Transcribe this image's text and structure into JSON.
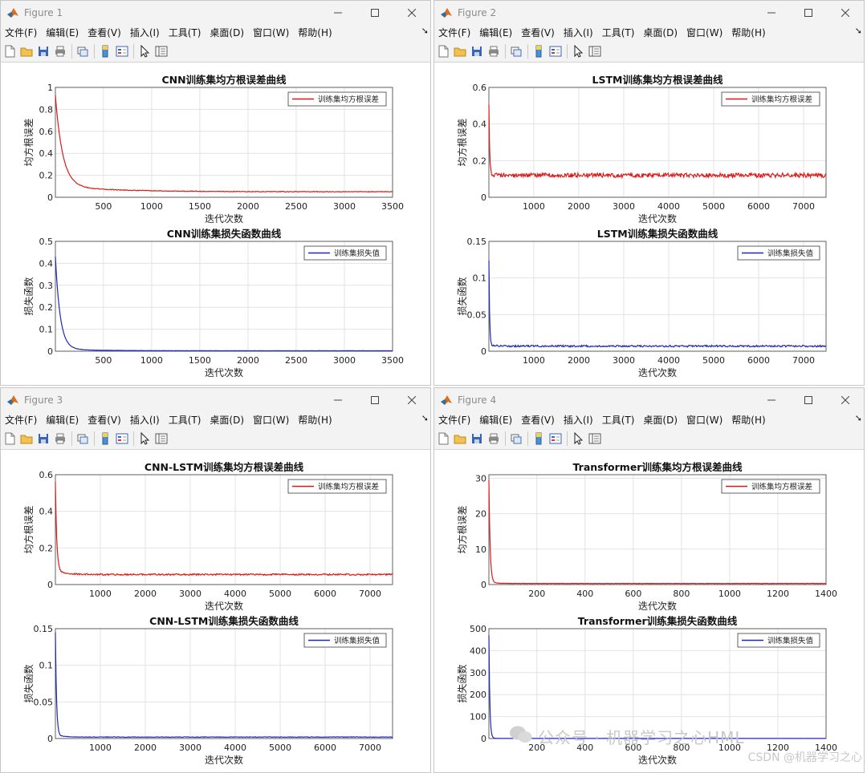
{
  "menu": [
    "文件(F)",
    "编辑(E)",
    "查看(V)",
    "插入(I)",
    "工具(T)",
    "桌面(D)",
    "窗口(W)",
    "帮助(H)"
  ],
  "toolbar": [
    "new-file-icon",
    "open-folder-icon",
    "save-icon",
    "print-icon",
    "link-figure-icon",
    "colorbar-icon",
    "legend-icon",
    "pointer-icon",
    "property-inspector-icon"
  ],
  "colors": {
    "rmse_line": "#dd1a1a",
    "loss_line": "#1f27b8",
    "grid": "#e2e2e2"
  },
  "windows": [
    {
      "title": "Figure 1",
      "charts": [
        {
          "title": "CNN训练集均方根误差曲线",
          "xlabel": "迭代次数",
          "ylabel": "均方根误差",
          "xlim": [
            1,
            3500
          ],
          "ylim": [
            0,
            1
          ],
          "xticks": [
            500,
            1000,
            1500,
            2000,
            2500,
            3000,
            3500
          ],
          "yticks": [
            0,
            0.2,
            0.4,
            0.6,
            0.8,
            1
          ],
          "ytick_labels": [
            "0",
            "0.2",
            "0.4",
            "0.6",
            "0.8",
            "1"
          ],
          "legend": "训练集均方根误差",
          "color": "rmse",
          "curve": {
            "peak": 0.93,
            "mid": 0.1,
            "floor": 0.05,
            "knee": 300,
            "noise": 0.003
          }
        },
        {
          "title": "CNN训练集损失函数曲线",
          "xlabel": "迭代次数",
          "ylabel": "损失函数",
          "xlim": [
            1,
            3500
          ],
          "ylim": [
            0,
            0.5
          ],
          "xticks": [
            500,
            1000,
            1500,
            2000,
            2500,
            3000,
            3500
          ],
          "yticks": [
            0,
            0.1,
            0.2,
            0.3,
            0.4,
            0.5
          ],
          "ytick_labels": [
            "0",
            "0.1",
            "0.2",
            "0.3",
            "0.4",
            "0.5"
          ],
          "legend": "训练集损失值",
          "color": "loss",
          "curve": {
            "peak": 0.43,
            "mid": 0.01,
            "floor": 0.002,
            "knee": 200,
            "noise": 0.0005
          }
        }
      ]
    },
    {
      "title": "Figure 2",
      "charts": [
        {
          "title": "LSTM训练集均方根误差曲线",
          "xlabel": "迭代次数",
          "ylabel": "均方根误差",
          "xlim": [
            1,
            7500
          ],
          "ylim": [
            0,
            0.6
          ],
          "xticks": [
            1000,
            2000,
            3000,
            4000,
            5000,
            6000,
            7000
          ],
          "yticks": [
            0,
            0.2,
            0.4,
            0.6
          ],
          "ytick_labels": [
            "0",
            "0.2",
            "0.4",
            "0.6"
          ],
          "legend": "训练集均方根误差",
          "color": "rmse",
          "curve": {
            "peak": 0.5,
            "mid": 0.13,
            "floor": 0.12,
            "knee": 60,
            "noise": 0.012
          }
        },
        {
          "title": "LSTM训练集损失函数曲线",
          "xlabel": "迭代次数",
          "ylabel": "损失函数",
          "xlim": [
            1,
            7500
          ],
          "ylim": [
            0,
            0.15
          ],
          "xticks": [
            1000,
            2000,
            3000,
            4000,
            5000,
            6000,
            7000
          ],
          "yticks": [
            0,
            0.05,
            0.1,
            0.15
          ],
          "ytick_labels": [
            "0",
            "0.05",
            "0.1",
            "0.15"
          ],
          "legend": "训练集损失值",
          "color": "loss",
          "curve": {
            "peak": 0.125,
            "mid": 0.008,
            "floor": 0.007,
            "knee": 60,
            "noise": 0.0012
          }
        }
      ]
    },
    {
      "title": "Figure 3",
      "charts": [
        {
          "title": "CNN-LSTM训练集均方根误差曲线",
          "xlabel": "迭代次数",
          "ylabel": "均方根误差",
          "xlim": [
            1,
            7500
          ],
          "ylim": [
            0,
            0.6
          ],
          "xticks": [
            1000,
            2000,
            3000,
            4000,
            5000,
            6000,
            7000
          ],
          "yticks": [
            0,
            0.2,
            0.4,
            0.6
          ],
          "ytick_labels": [
            "0",
            "0.2",
            "0.4",
            "0.6"
          ],
          "legend": "训练集均方根误差",
          "color": "rmse",
          "curve": {
            "peak": 0.56,
            "mid": 0.075,
            "floor": 0.055,
            "knee": 120,
            "noise": 0.004
          }
        },
        {
          "title": "CNN-LSTM训练集损失函数曲线",
          "xlabel": "迭代次数",
          "ylabel": "损失函数",
          "xlim": [
            1,
            7500
          ],
          "ylim": [
            0,
            0.15
          ],
          "xticks": [
            1000,
            2000,
            3000,
            4000,
            5000,
            6000,
            7000
          ],
          "yticks": [
            0,
            0.05,
            0.1,
            0.15
          ],
          "ytick_labels": [
            "0",
            "0.05",
            "0.1",
            "0.15"
          ],
          "legend": "训练集损失值",
          "color": "loss",
          "curve": {
            "peak": 0.145,
            "mid": 0.004,
            "floor": 0.002,
            "knee": 100,
            "noise": 0.0004
          }
        }
      ]
    },
    {
      "title": "Figure 4",
      "charts": [
        {
          "title": "Transformer训练集均方根误差曲线",
          "xlabel": "迭代次数",
          "ylabel": "均方根误差",
          "xlim": [
            1,
            1400
          ],
          "ylim": [
            0,
            31
          ],
          "xticks": [
            200,
            400,
            600,
            800,
            1000,
            1200,
            1400
          ],
          "yticks": [
            0,
            10,
            20,
            30
          ],
          "ytick_labels": [
            "0",
            "10",
            "20",
            "30"
          ],
          "legend": "训练集均方根误差",
          "color": "rmse",
          "curve": {
            "peak": 29.5,
            "mid": 0.5,
            "floor": 0.3,
            "knee": 20,
            "noise": 0.05
          }
        },
        {
          "title": "Transformer训练集损失函数曲线",
          "xlabel": "迭代次数",
          "ylabel": "损失函数",
          "xlim": [
            1,
            1400
          ],
          "ylim": [
            0,
            500
          ],
          "xticks": [
            200,
            400,
            600,
            800,
            1000,
            1200,
            1400
          ],
          "yticks": [
            0,
            100,
            200,
            300,
            400,
            500
          ],
          "ytick_labels": [
            "0",
            "100",
            "200",
            "300",
            "400",
            "500"
          ],
          "legend": "训练集损失值",
          "color": "loss",
          "curve": {
            "peak": 470,
            "mid": 1,
            "floor": 0.5,
            "knee": 15,
            "noise": 0.2
          }
        }
      ]
    }
  ],
  "watermark": {
    "main": "公众号 · 机器学习之心HML",
    "sub": "CSDN @机器学习之心"
  },
  "chart_data": [
    {
      "type": "line",
      "title": "CNN训练集均方根误差曲线",
      "xlabel": "迭代次数",
      "ylabel": "均方根误差",
      "xlim": [
        1,
        3500
      ],
      "ylim": [
        0,
        1
      ],
      "legend": "训练集均方根误差",
      "series": [
        {
          "name": "训练集均方根误差",
          "x": [
            1,
            50,
            100,
            200,
            300,
            500,
            1000,
            2000,
            3000,
            3500
          ],
          "y": [
            0.93,
            0.45,
            0.25,
            0.1,
            0.06,
            0.05,
            0.05,
            0.05,
            0.05,
            0.05
          ]
        }
      ]
    },
    {
      "type": "line",
      "title": "CNN训练集损失函数曲线",
      "xlabel": "迭代次数",
      "ylabel": "损失函数",
      "xlim": [
        1,
        3500
      ],
      "ylim": [
        0,
        0.5
      ],
      "legend": "训练集损失值",
      "series": [
        {
          "name": "训练集损失值",
          "x": [
            1,
            25,
            50,
            100,
            200,
            500,
            1000,
            2000,
            3500
          ],
          "y": [
            0.43,
            0.15,
            0.06,
            0.02,
            0.005,
            0.002,
            0.002,
            0.002,
            0.002
          ]
        }
      ]
    },
    {
      "type": "line",
      "title": "LSTM训练集均方根误差曲线",
      "xlabel": "迭代次数",
      "ylabel": "均方根误差",
      "xlim": [
        1,
        7500
      ],
      "ylim": [
        0,
        0.6
      ],
      "legend": "训练集均方根误差",
      "series": [
        {
          "name": "训练集均方根误差",
          "x": [
            1,
            30,
            100,
            1000,
            3000,
            5000,
            7000,
            7500
          ],
          "y": [
            0.5,
            0.2,
            0.13,
            0.12,
            0.12,
            0.12,
            0.11,
            0.11
          ]
        }
      ]
    },
    {
      "type": "line",
      "title": "LSTM训练集损失函数曲线",
      "xlabel": "迭代次数",
      "ylabel": "损失函数",
      "xlim": [
        1,
        7500
      ],
      "ylim": [
        0,
        0.15
      ],
      "legend": "训练集损失值",
      "series": [
        {
          "name": "训练集损失值",
          "x": [
            1,
            30,
            100,
            1000,
            3000,
            5000,
            7500
          ],
          "y": [
            0.125,
            0.025,
            0.008,
            0.007,
            0.007,
            0.007,
            0.006
          ]
        }
      ]
    },
    {
      "type": "line",
      "title": "CNN-LSTM训练集均方根误差曲线",
      "xlabel": "迭代次数",
      "ylabel": "均方根误差",
      "xlim": [
        1,
        7500
      ],
      "ylim": [
        0,
        0.6
      ],
      "legend": "训练集均方根误差",
      "series": [
        {
          "name": "训练集均方根误差",
          "x": [
            1,
            50,
            200,
            1000,
            3000,
            5000,
            7500
          ],
          "y": [
            0.56,
            0.15,
            0.075,
            0.065,
            0.06,
            0.055,
            0.055
          ]
        }
      ]
    },
    {
      "type": "line",
      "title": "CNN-LSTM训练集损失函数曲线",
      "xlabel": "迭代次数",
      "ylabel": "损失函数",
      "xlim": [
        1,
        7500
      ],
      "ylim": [
        0,
        0.15
      ],
      "legend": "训练集损失值",
      "series": [
        {
          "name": "训练集损失值",
          "x": [
            1,
            50,
            200,
            1000,
            3000,
            7500
          ],
          "y": [
            0.145,
            0.02,
            0.004,
            0.003,
            0.002,
            0.002
          ]
        }
      ]
    },
    {
      "type": "line",
      "title": "Transformer训练集均方根误差曲线",
      "xlabel": "迭代次数",
      "ylabel": "均方根误差",
      "xlim": [
        1,
        1400
      ],
      "ylim": [
        0,
        31
      ],
      "legend": "训练集均方根误差",
      "series": [
        {
          "name": "训练集均方根误差",
          "x": [
            1,
            10,
            30,
            100,
            400,
            1000,
            1400
          ],
          "y": [
            29.5,
            8,
            1.5,
            0.5,
            0.3,
            0.3,
            0.3
          ]
        }
      ]
    },
    {
      "type": "line",
      "title": "Transformer训练集损失函数曲线",
      "xlabel": "迭代次数",
      "ylabel": "损失函数",
      "xlim": [
        1,
        1400
      ],
      "ylim": [
        0,
        500
      ],
      "legend": "训练集损失值",
      "series": [
        {
          "name": "训练集损失值",
          "x": [
            1,
            5,
            20,
            100,
            400,
            1000,
            1400
          ],
          "y": [
            470,
            120,
            10,
            1,
            0.5,
            0.5,
            0.5
          ]
        }
      ]
    }
  ]
}
